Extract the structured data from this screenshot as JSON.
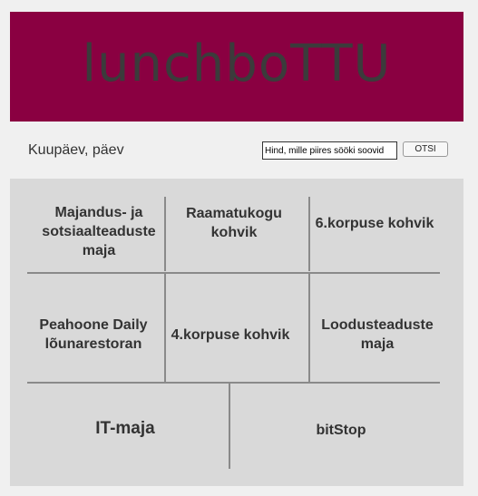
{
  "header": {
    "title": "lunchboTTU"
  },
  "toolbar": {
    "date_label": "Kuupäev, päev",
    "search_placeholder": "Hind, mille piires sööki soovid",
    "search_button": "OTSI"
  },
  "places": [
    "Majandus- ja sotsiaalteaduste maja",
    "Raamatukogu kohvik",
    "6.korpuse kohvik",
    "Peahoone Daily lõunarestoran",
    "4.korpuse kohvik",
    "Loodusteaduste maja",
    "IT-maja",
    "bitStop"
  ],
  "colors": {
    "banner": "#8a0041",
    "grid_bg": "#d9d9d9",
    "divider": "#8a8a8a"
  }
}
